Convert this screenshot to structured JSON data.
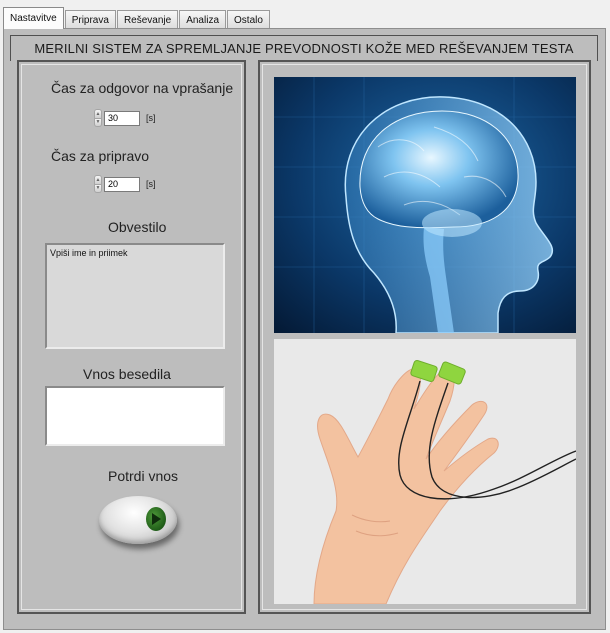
{
  "tabs": [
    {
      "label": "Nastavitve",
      "active": true
    },
    {
      "label": "Priprava",
      "active": false
    },
    {
      "label": "Reševanje",
      "active": false
    },
    {
      "label": "Analiza",
      "active": false
    },
    {
      "label": "Ostalo",
      "active": false
    }
  ],
  "header": {
    "title": "MERILNI SISTEM ZA SPREMLJANJE PREVODNOSTI KOŽE MED REŠEVANJEM TESTA"
  },
  "answer_time": {
    "label": "Čas za odgovor na vprašanje",
    "value": "30",
    "unit": "[s]"
  },
  "prep_time": {
    "label": "Čas za pripravo",
    "value": "20",
    "unit": "[s]"
  },
  "notice": {
    "label": "Obvestilo",
    "text": "Vpiši ime in priimek"
  },
  "text_input": {
    "label": "Vnos besedila",
    "value": ""
  },
  "confirm": {
    "label": "Potrdi vnos"
  },
  "images": {
    "top": "brain-head-xray-image",
    "bottom": "hand-with-finger-electrodes-image"
  },
  "colors": {
    "panel": "#bdbdbd",
    "brain_bg": "#0c3a6e",
    "electrode": "#8cd43c",
    "skin": "#f2bd98",
    "button_led": "#2f7a25"
  }
}
